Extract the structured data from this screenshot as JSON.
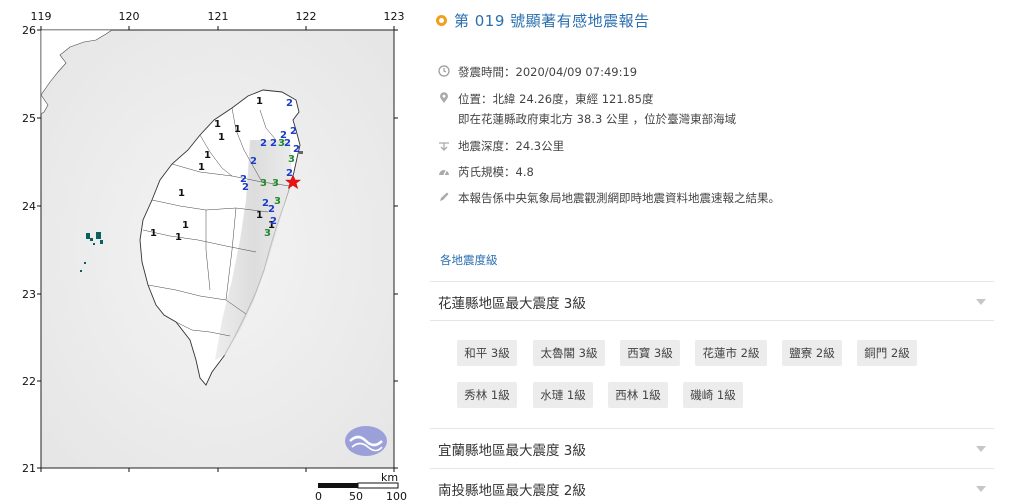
{
  "map": {
    "lon_ticks": [
      "119",
      "120",
      "121",
      "122",
      "123"
    ],
    "lat_ticks": [
      "26",
      "25",
      "24",
      "23",
      "22",
      "21"
    ],
    "scale_unit": "km",
    "scale_ticks": [
      "0",
      "50",
      "100"
    ],
    "intensity_labels": [
      {
        "v": "1",
        "c": "#111"
      },
      {
        "v": "1",
        "c": "#111"
      },
      {
        "v": "1",
        "c": "#111"
      },
      {
        "v": "1",
        "c": "#111"
      },
      {
        "v": "1",
        "c": "#111"
      },
      {
        "v": "1",
        "c": "#111"
      },
      {
        "v": "1",
        "c": "#111"
      },
      {
        "v": "1",
        "c": "#111"
      },
      {
        "v": "1",
        "c": "#111"
      },
      {
        "v": "1",
        "c": "#111"
      },
      {
        "v": "1",
        "c": "#111"
      },
      {
        "v": "1",
        "c": "#111"
      },
      {
        "v": "2",
        "c": "#1a3cc8"
      },
      {
        "v": "2",
        "c": "#1a3cc8"
      },
      {
        "v": "2",
        "c": "#1a3cc8"
      },
      {
        "v": "2",
        "c": "#1a3cc8"
      },
      {
        "v": "2",
        "c": "#1a3cc8"
      },
      {
        "v": "2",
        "c": "#1a3cc8"
      },
      {
        "v": "2",
        "c": "#1a3cc8"
      },
      {
        "v": "2",
        "c": "#1a3cc8"
      },
      {
        "v": "2",
        "c": "#1a3cc8"
      },
      {
        "v": "2",
        "c": "#1a3cc8"
      },
      {
        "v": "2",
        "c": "#1a3cc8"
      },
      {
        "v": "2",
        "c": "#1a3cc8"
      },
      {
        "v": "2",
        "c": "#1a3cc8"
      },
      {
        "v": "2",
        "c": "#1a3cc8"
      },
      {
        "v": "3",
        "c": "#1f8a2a"
      },
      {
        "v": "3",
        "c": "#1f8a2a"
      },
      {
        "v": "3",
        "c": "#1f8a2a"
      },
      {
        "v": "3",
        "c": "#1f8a2a"
      },
      {
        "v": "3",
        "c": "#1f8a2a"
      },
      {
        "v": "3",
        "c": "#1f8a2a"
      }
    ]
  },
  "report": {
    "title": "第 019 號顯著有感地震報告",
    "time_label": "發震時間：2020/04/09 07:49:19",
    "location_label": "位置：北緯 24.26度，東經 121.85度",
    "location_detail": "即在花蓮縣政府東北方 38.3 公里 ，位於臺灣東部海域",
    "depth_label": "地震深度：24.3公里",
    "magnitude_label": "芮氏規模：4.8",
    "note": "本報告係中央氣象局地震觀測網即時地震資料地震速報之結果。",
    "area_heading": "各地震度級",
    "sections": [
      {
        "label": "花蓮縣地區最大震度 3級"
      },
      {
        "label": "宜蘭縣地區最大震度 3級"
      },
      {
        "label": "南投縣地區最大震度 2級"
      }
    ],
    "stations": [
      "和平 3級",
      "太魯閣 3級",
      "西寶 3級",
      "花蓮市 2級",
      "鹽寮 2級",
      "銅門 2級",
      "秀林 1級",
      "水璉 1級",
      "西林 1級",
      "磯崎 1級"
    ]
  }
}
